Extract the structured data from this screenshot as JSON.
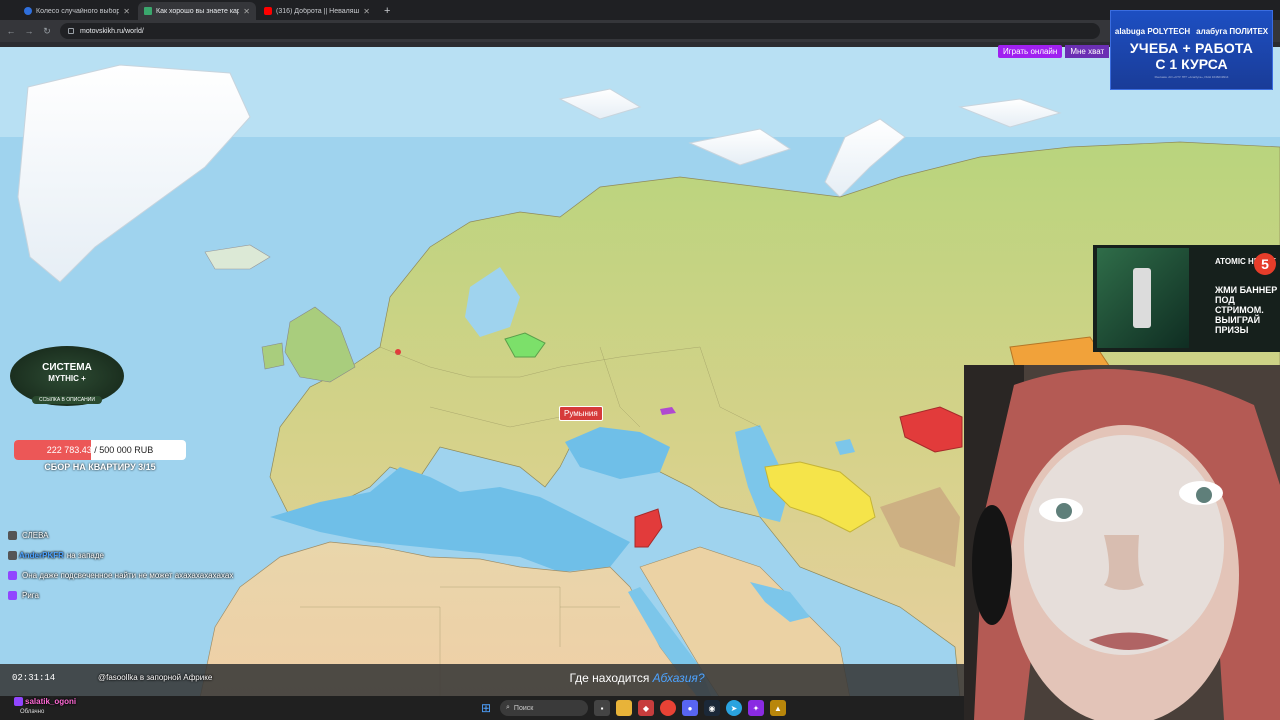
{
  "browser": {
    "tabs": [
      {
        "title": "Колесо случайного выбора -",
        "color": "#2f6fdc",
        "active": false
      },
      {
        "title": "Как хорошо вы знаете карт",
        "color": "#3aa76d",
        "active": true
      },
      {
        "title": "(316) Доброта || Неваляшка ||",
        "color": "#ff0000",
        "active": false
      }
    ],
    "close_glyph": "✕",
    "new_tab_glyph": "+",
    "url": "motovskikh.ru/world/",
    "nav": {
      "back": "←",
      "forward": "→",
      "reload": "↻"
    }
  },
  "map": {
    "ocean_color": "#9fd3ee",
    "land_color": "#d9d08a",
    "highlighted_colors": {
      "lithuania": "#7ce06a",
      "turkmenistan": "#f5e44a",
      "kyrgyzstan_tajik": "#e23b3b",
      "jordan": "#e23b3b",
      "georgia": "#b04ad0"
    },
    "tooltip": "Румыния"
  },
  "overlays": {
    "play_button": "Играть онлайн",
    "play_more": "Мне хват",
    "ad1": {
      "brand_left": "alabuga POLYTECH",
      "brand_right": "алабуга ПОЛИТЕХ",
      "line1": "УЧЕБА + РАБОТА",
      "line2": "С 1 КУРСА",
      "fine": "Реклама. АО «СТУ ПТГ «Алабуга», ИНН 1646019914"
    },
    "ad2": {
      "logo": "ATOMIC HEART",
      "channel": "5",
      "text": "ЖМИ БАННЕР ПОД СТРИМОМ. ВЫИГРАЙ ПРИЗЫ"
    },
    "mythic": {
      "title": "СИСТЕМА",
      "subtitle": "MYTHIC +",
      "link": "ССЫЛКА В ОПИСАНИИ"
    },
    "goal": {
      "raised": "222 783.43",
      "target": "/ 500 000 RUB",
      "progress": 0.4456,
      "title": "СБОР НА КВАРТИРУ 3/15"
    }
  },
  "chat": [
    {
      "user": "",
      "text": "СЛЕВА"
    },
    {
      "user": "AnderPKFR",
      "text": "на западе"
    },
    {
      "user": "",
      "text": "Она даже подсвеченное найти не может ахахахахахахах"
    },
    {
      "user": "",
      "text": "Рига"
    }
  ],
  "bottom": {
    "timer": "02:31:14",
    "overlay_user": "fasoollka",
    "overlay_text": "@fasoollka в запорной Африке",
    "question_prefix": "Где находится",
    "question_place": "Абхазия?",
    "last_user": "salatik_ogoni"
  },
  "taskbar": {
    "weather": "Облачно",
    "search": "Поиск"
  }
}
